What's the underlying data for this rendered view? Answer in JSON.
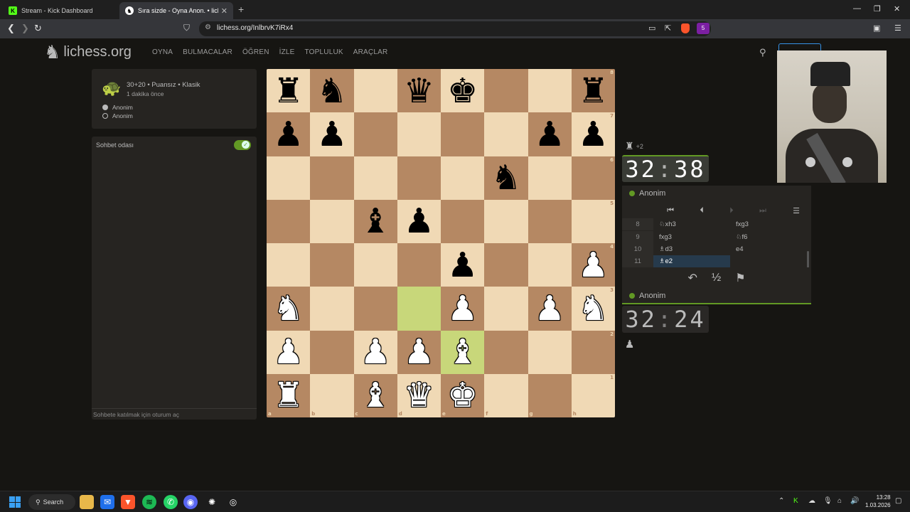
{
  "browser": {
    "tabs": [
      {
        "title": "Stream - Kick Dashboard",
        "icon": "kick-icon"
      },
      {
        "title": "Sıra sizde - Oyna Anon. • liches…",
        "icon": "lichess-icon"
      }
    ],
    "url": "lichess.org/InlbrvK7iRx4",
    "extension_badge": "5"
  },
  "site": {
    "logo": "lichess.org",
    "nav": [
      "OYNA",
      "BULMACALAR",
      "ÖĞREN",
      "İZLE",
      "TOPLULUK",
      "ARAÇLAR"
    ]
  },
  "game_info": {
    "mode": "30+20 • Puansız • Klasik",
    "ago": "1 dakika önce",
    "black_player": "Anonim",
    "white_player": "Anonim"
  },
  "chat": {
    "title": "Sohbet odası",
    "footer": "Sohbete katılmak için oturum aç"
  },
  "board": {
    "ranks": [
      "8",
      "7",
      "6",
      "5",
      "4",
      "3",
      "2",
      "1"
    ],
    "files": [
      "a",
      "b",
      "c",
      "d",
      "e",
      "f",
      "g",
      "h"
    ],
    "position": [
      [
        "br",
        "bn",
        "",
        "bq",
        "bk",
        "",
        "",
        "br"
      ],
      [
        "bp",
        "bp",
        "",
        "",
        "",
        "",
        "bp",
        "bp"
      ],
      [
        "",
        "",
        "",
        "",
        "",
        "bn",
        "",
        ""
      ],
      [
        "",
        "",
        "bb",
        "bp",
        "",
        "",
        "",
        ""
      ],
      [
        "",
        "",
        "",
        "",
        "bp",
        "",
        "",
        "wp"
      ],
      [
        "wn",
        "",
        "",
        "",
        "wp",
        "",
        "wp",
        "wn"
      ],
      [
        "wp",
        "",
        "wp",
        "wp",
        "wb",
        "",
        "",
        ""
      ],
      [
        "wr",
        "",
        "wb",
        "wq",
        "wk",
        "",
        "",
        ""
      ]
    ],
    "last_move": [
      "d3",
      "e2"
    ]
  },
  "opponent": {
    "material": "+2",
    "clock_min": "32",
    "clock_sec": "38",
    "name": "Anonim"
  },
  "player": {
    "clock_min": "32",
    "clock_sec": "24",
    "name": "Anonim"
  },
  "moves": [
    {
      "n": "8",
      "w": "♘xh3",
      "b": "fxg3"
    },
    {
      "n": "9",
      "w": "fxg3",
      "b": "♘f6"
    },
    {
      "n": "10",
      "w": "♗d3",
      "b": "e4"
    },
    {
      "n": "11",
      "w": "♗e2",
      "b": ""
    }
  ],
  "actions": {
    "takeback": "↶",
    "draw": "½",
    "resign": "⚑"
  },
  "taskbar": {
    "search": "Search",
    "time": "13:28",
    "date": "1.03.2026"
  }
}
